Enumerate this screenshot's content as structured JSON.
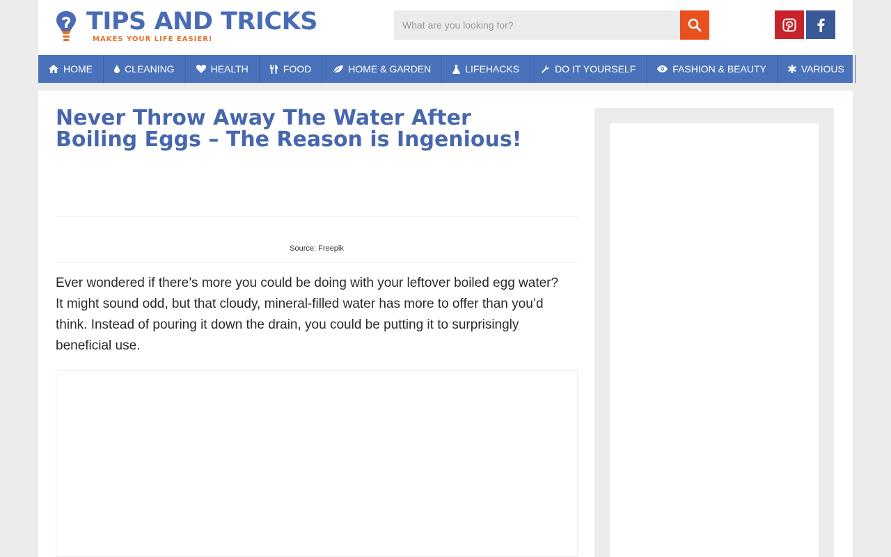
{
  "logo": {
    "title": "TIPS AND TRICKS",
    "subtitle": "MAKES YOUR LIFE EASIER!",
    "icon": "lightbulb-question-icon"
  },
  "search": {
    "placeholder": "What are you looking for?",
    "value": "",
    "icon": "search-icon"
  },
  "social": [
    {
      "name": "pinterest",
      "icon": "pinterest-icon",
      "color": "#c8232c"
    },
    {
      "name": "facebook",
      "icon": "facebook-icon",
      "color": "#3b5998"
    }
  ],
  "nav": {
    "items": [
      {
        "label": "HOME",
        "icon": "home-icon"
      },
      {
        "label": "CLEANING",
        "icon": "drop-icon"
      },
      {
        "label": "HEALTH",
        "icon": "heart-icon"
      },
      {
        "label": "FOOD",
        "icon": "utensils-icon"
      },
      {
        "label": "HOME & GARDEN",
        "icon": "leaf-icon"
      },
      {
        "label": "LIFEHACKS",
        "icon": "flask-icon"
      },
      {
        "label": "DO IT YOURSELF",
        "icon": "wrench-icon"
      },
      {
        "label": "FASHION & BEAUTY",
        "icon": "eye-icon"
      },
      {
        "label": "VARIOUS",
        "icon": "asterisk-icon"
      }
    ]
  },
  "article": {
    "title": "Never Throw Away The Water After Boiling Eggs – The Reason is Ingenious!",
    "image_source": "Source: Freepik",
    "paragraph": "Ever wondered if there’s more you could be doing with your leftover boiled egg water? It might sound odd, but that cloudy, mineral-filled water has more to offer than you’d think. Instead of pouring it down the drain, you could be putting it to surprisingly beneficial use."
  },
  "colors": {
    "brand_blue": "#4a72bb",
    "title_blue": "#4767ad",
    "accent_orange": "#e8511f",
    "page_background": "#ececec"
  }
}
